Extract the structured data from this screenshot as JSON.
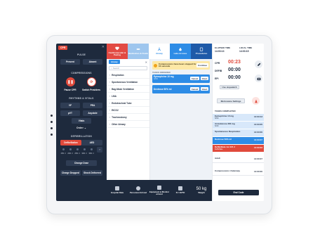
{
  "left_panel": {
    "tag": "CPR",
    "pulse": {
      "title": "PULSE",
      "present": "Present",
      "absent": "Absent"
    },
    "compressions": {
      "title": "COMPRESSIONS",
      "pause": "Pause CPR",
      "switch": "Switch Providers"
    },
    "rhythms": {
      "title": "RHYTHMS & VITALS",
      "vf": "VF",
      "pea": "PEA",
      "pvt": "pVT",
      "asystole": "Asystole",
      "vitals": "Vitals",
      "order": "Order"
    },
    "defib": {
      "title": "DEFIBRILLATION",
      "defib": "Defibrillation",
      "aed": "AED",
      "energies": [
        "150 J",
        "200 J",
        "250 J",
        "300 J",
        "360 J"
      ],
      "change_dose": "Change Dose",
      "charge_dropped": "Charge Dropped",
      "shock_delivered": "Shock Delivered"
    }
  },
  "tabs": [
    {
      "label": "Cardiovascular & Pacing",
      "color": "#e24a43"
    },
    {
      "label": "Medication & Fluids",
      "color": "#9ec6ee"
    },
    {
      "label": "Airway",
      "color": "#ffffff"
    },
    {
      "label": "Labs & Lines",
      "color": "#2d8ce6"
    },
    {
      "label": "Procedures",
      "color": "#1e5aa8"
    }
  ],
  "mid": {
    "chip": "Airway",
    "search_placeholder": "Search",
    "items": [
      "Respiration",
      "Spontaneous Ventilation",
      "Bag-Mask Ventilation",
      "LMA",
      "Endotracheal Tube",
      "EtCO2",
      "Tracheostomy",
      "Other Airway"
    ]
  },
  "center": {
    "banner": "Compressions have been stopped for 10 seconds",
    "banner_btn": "Continue",
    "tasks_ordered": "TASKS ORDERED",
    "cards": [
      {
        "name": "Epinephrine 10 mg",
        "sub": "IV/IO",
        "cancel": "Cancel",
        "given": "Given"
      },
      {
        "name": "Dextrose 50% ml",
        "sub": "",
        "cancel": "Cancel",
        "given": "Given"
      }
    ]
  },
  "bottom": [
    {
      "label": "Hospital Data",
      "big": ""
    },
    {
      "label": "Personnel Arrived",
      "big": ""
    },
    {
      "label": "Equipment & Monitor arrived",
      "big": ""
    },
    {
      "label": "IV / IO/TO",
      "big": ""
    },
    {
      "label": "Weight",
      "big": "50 kg"
    }
  ],
  "right": {
    "elapsed_label": "ELAPSED TIME",
    "elapsed_value": "14:03:13",
    "local_label": "LOCAL TIME",
    "local_value": "14:03:15",
    "timers": [
      {
        "label": "CPR",
        "value": "00:23",
        "color": "#e04a3c"
      },
      {
        "label": "DEFIB",
        "value": "00:00",
        "color": "#1e2a3d"
      },
      {
        "label": "EPI",
        "value": "00:00",
        "color": "#1e2a3d"
      }
    ],
    "stopwatch": "Use stopwatch",
    "metronome": "Metronome Settings",
    "tasks_completed": "TASKS COMPLETED",
    "completed": [
      {
        "name": "Epinephrine 10 mg",
        "sub": "IV/IO",
        "time": "14:03:13",
        "bg": "#d8e8fa",
        "fg": "#1e2a3d"
      },
      {
        "name": "Amiodarone 300 mg",
        "sub": "IV/IO",
        "time": "14:03:05",
        "bg": "#d8e8fa",
        "fg": "#1e2a3d"
      },
      {
        "name": "Spontaneous Respiration",
        "sub": "",
        "time": "14:03:00",
        "bg": "#d8e8fa",
        "fg": "#1e2a3d"
      },
      {
        "name": "Dextrose 50% ml",
        "sub": "",
        "time": "14:03:07",
        "bg": "#2d8ce6",
        "fg": "#ffffff"
      },
      {
        "name": "Defibrillate 1st 115 J",
        "sub": "Defibrillate",
        "time": "14:03:03",
        "bg": "#e04a3c",
        "fg": "#ffffff"
      },
      {
        "name": "Adult",
        "sub": "",
        "time": "14:00:07",
        "bg": "#ffffff",
        "fg": "#1e2a3d"
      },
      {
        "name": "Compressions Underway",
        "sub": "",
        "time": "14:00:00",
        "bg": "#ffffff",
        "fg": "#1e2a3d"
      }
    ],
    "end_code": "End Code"
  }
}
